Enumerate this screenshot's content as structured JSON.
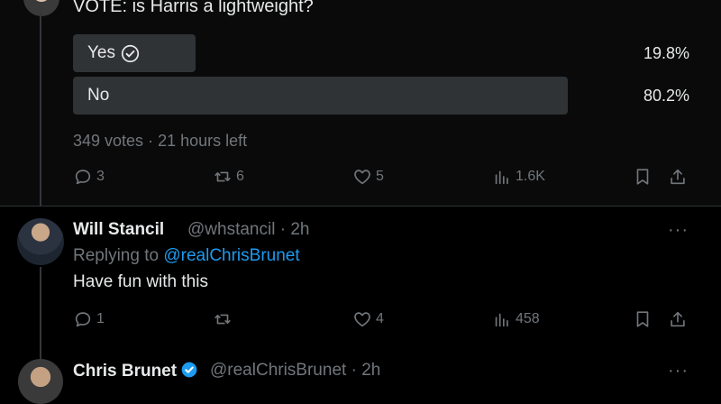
{
  "poll_tweet": {
    "question": "VOTE: is Harris a lightweight?",
    "options": [
      {
        "label": "Yes",
        "percent": "19.8%",
        "selected": true
      },
      {
        "label": "No",
        "percent": "80.2%",
        "selected": false
      }
    ],
    "votes": "349 votes",
    "time_left": "21 hours left",
    "actions": {
      "replies": "3",
      "reposts": "6",
      "likes": "5",
      "views": "1.6K"
    }
  },
  "reply_tweet": {
    "name": "Will Stancil",
    "handle": "@whstancil",
    "time": "2h",
    "replying_to_prefix": "Replying to",
    "replying_to_handle": "@realChrisBrunet",
    "text": "Have fun with this",
    "actions": {
      "replies": "1",
      "reposts": "",
      "likes": "4",
      "views": "458"
    }
  },
  "next_tweet": {
    "name": "Chris Brunet",
    "handle": "@realChrisBrunet",
    "time": "2h",
    "verified": true
  },
  "separator": "·",
  "colors": {
    "background": "#000000",
    "text": "#e7e9ea",
    "muted": "#71767b",
    "link": "#1d9bf0",
    "poll_bar": "#2f3336"
  }
}
